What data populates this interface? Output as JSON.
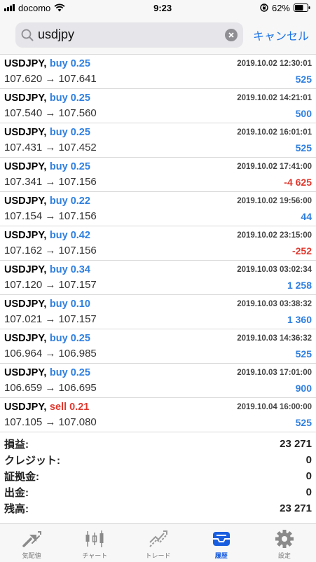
{
  "status": {
    "carrier": "docomo",
    "time": "9:23",
    "battery": "62%"
  },
  "search": {
    "value": "usdjpy",
    "cancel_label": "キャンセル"
  },
  "trades": [
    {
      "symbol": "USDJPY,",
      "side": "buy",
      "side_label": "buy 0.25",
      "date": "2019.10.02 12:30:01",
      "prices": "107.620 → 107.641",
      "profit": "525",
      "profit_sign": "pos"
    },
    {
      "symbol": "USDJPY,",
      "side": "buy",
      "side_label": "buy 0.25",
      "date": "2019.10.02 14:21:01",
      "prices": "107.540 → 107.560",
      "profit": "500",
      "profit_sign": "pos"
    },
    {
      "symbol": "USDJPY,",
      "side": "buy",
      "side_label": "buy 0.25",
      "date": "2019.10.02 16:01:01",
      "prices": "107.431 → 107.452",
      "profit": "525",
      "profit_sign": "pos"
    },
    {
      "symbol": "USDJPY,",
      "side": "buy",
      "side_label": "buy 0.25",
      "date": "2019.10.02 17:41:00",
      "prices": "107.341 → 107.156",
      "profit": "-4 625",
      "profit_sign": "neg"
    },
    {
      "symbol": "USDJPY,",
      "side": "buy",
      "side_label": "buy 0.22",
      "date": "2019.10.02 19:56:00",
      "prices": "107.154 → 107.156",
      "profit": "44",
      "profit_sign": "pos"
    },
    {
      "symbol": "USDJPY,",
      "side": "buy",
      "side_label": "buy 0.42",
      "date": "2019.10.02 23:15:00",
      "prices": "107.162 → 107.156",
      "profit": "-252",
      "profit_sign": "neg"
    },
    {
      "symbol": "USDJPY,",
      "side": "buy",
      "side_label": "buy 0.34",
      "date": "2019.10.03 03:02:34",
      "prices": "107.120 → 107.157",
      "profit": "1 258",
      "profit_sign": "pos"
    },
    {
      "symbol": "USDJPY,",
      "side": "buy",
      "side_label": "buy 0.10",
      "date": "2019.10.03 03:38:32",
      "prices": "107.021 → 107.157",
      "profit": "1 360",
      "profit_sign": "pos"
    },
    {
      "symbol": "USDJPY,",
      "side": "buy",
      "side_label": "buy 0.25",
      "date": "2019.10.03 14:36:32",
      "prices": "106.964 → 106.985",
      "profit": "525",
      "profit_sign": "pos"
    },
    {
      "symbol": "USDJPY,",
      "side": "buy",
      "side_label": "buy 0.25",
      "date": "2019.10.03 17:01:00",
      "prices": "106.659 → 106.695",
      "profit": "900",
      "profit_sign": "pos"
    },
    {
      "symbol": "USDJPY,",
      "side": "sell",
      "side_label": "sell 0.21",
      "date": "2019.10.04 16:00:00",
      "prices": "107.105 → 107.080",
      "profit": "525",
      "profit_sign": "pos"
    }
  ],
  "summary": [
    {
      "label": "損益:",
      "value": "23 271"
    },
    {
      "label": "クレジット:",
      "value": "0"
    },
    {
      "label": "証拠金:",
      "value": "0"
    },
    {
      "label": "出金:",
      "value": "0"
    },
    {
      "label": "残高:",
      "value": "23 271"
    }
  ],
  "tabs": [
    {
      "key": "quotes",
      "label": "気配値",
      "icon": "quotes-icon",
      "active": false
    },
    {
      "key": "chart",
      "label": "チャート",
      "icon": "chart-icon",
      "active": false
    },
    {
      "key": "trade",
      "label": "トレード",
      "icon": "trade-icon",
      "active": false
    },
    {
      "key": "history",
      "label": "履歴",
      "icon": "history-icon",
      "active": true
    },
    {
      "key": "settings",
      "label": "設定",
      "icon": "gear-icon",
      "active": false
    }
  ],
  "colors": {
    "buy": "#2f7fe0",
    "sell": "#e0382e",
    "accent": "#1a5ee0",
    "profit_pos": "#2f7fe0",
    "profit_neg": "#e0382e"
  }
}
